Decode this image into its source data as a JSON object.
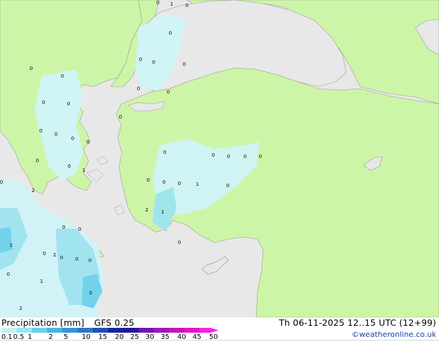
{
  "header": {
    "title": "Precipitation [mm]",
    "model": "GFS 0.25",
    "valid_time": "Th 06-11-2025 12..15 UTC (12+99)"
  },
  "footer": {
    "credit": "©weatheronline.co.uk"
  },
  "legend": {
    "ticks": [
      "0.1",
      "0.5",
      "1",
      "2",
      "5",
      "10",
      "15",
      "20",
      "25",
      "30",
      "35",
      "40",
      "45",
      "50"
    ],
    "colors": [
      "#c8f0f4",
      "#96e6f0",
      "#64d2ec",
      "#46b4e6",
      "#3296dc",
      "#2878c8",
      "#1e50b4",
      "#1428a0",
      "#2814a0",
      "#6e14b4",
      "#a014be",
      "#c814b4",
      "#e614c8",
      "#ff1ee6"
    ]
  },
  "map": {
    "colors": {
      "sea": "#e8e8e8",
      "land": "#cdf5a8",
      "precip_light": "#d0f4f8",
      "precip_mid": "#9ee4f0",
      "precip_heavy": "#6ed0ec",
      "border": "#9a9a9a"
    },
    "point_values": [
      "0",
      "1",
      "0",
      "0",
      "0",
      "0",
      "0",
      "0",
      "0",
      "0",
      "0",
      "0",
      "0",
      "0",
      "0",
      "0",
      "0",
      "0",
      "0",
      "0",
      "1",
      "0",
      "0",
      "0",
      "0",
      "0",
      "0",
      "0",
      "0",
      "1",
      "0",
      "0",
      "2",
      "0",
      "0",
      "1",
      "0",
      "2",
      "0",
      "0",
      "0",
      "2",
      "1",
      "0",
      "0",
      "1",
      "2",
      "0"
    ]
  }
}
